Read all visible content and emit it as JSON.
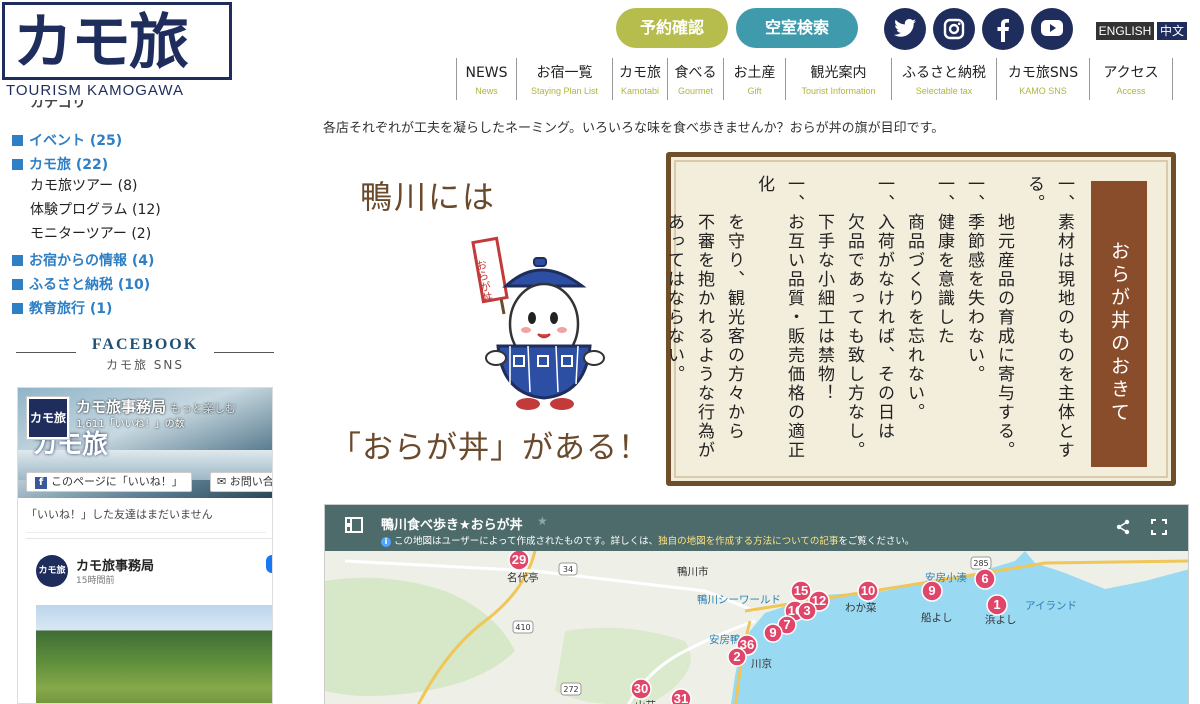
{
  "header": {
    "logo_jp": "カモ旅",
    "logo_en": "TOURISM KAMOGAWA",
    "btn_reserve": "予約確認",
    "btn_vacancy": "空室検索",
    "lang_en": "ENGLISH",
    "lang_zh": "中文",
    "social": [
      "twitter-icon",
      "instagram-icon",
      "facebook-icon",
      "youtube-icon"
    ],
    "nav": [
      {
        "jp": "NEWS",
        "en": "News"
      },
      {
        "jp": "お宿一覧",
        "en": "Staying Plan List"
      },
      {
        "jp": "カモ旅",
        "en": "Kamotabi"
      },
      {
        "jp": "食べる",
        "en": "Gourmet"
      },
      {
        "jp": "お土産",
        "en": "Gift"
      },
      {
        "jp": "観光案内",
        "en": "Tourist Information"
      },
      {
        "jp": "ふるさと納税",
        "en": "Selectable tax"
      },
      {
        "jp": "カモ旅SNS",
        "en": "KAMO SNS"
      },
      {
        "jp": "アクセス",
        "en": "Access"
      }
    ]
  },
  "sidebar": {
    "category_heading": "カテゴリー",
    "categories": [
      {
        "label": "イベント (25)"
      },
      {
        "label": "カモ旅 (22)",
        "children": [
          "カモ旅ツアー (8)",
          "体験プログラム (12)",
          "モニターツアー (2)"
        ]
      },
      {
        "label": "お宿からの情報 (4)"
      },
      {
        "label": "ふるさと納税 (10)"
      },
      {
        "label": "教育旅行 (1)"
      }
    ],
    "facebook": {
      "title": "FACEBOOK",
      "subtitle": "カモ旅 SNS",
      "page_name": "カモ旅事務局",
      "likes": "1,611「いいね！」の数",
      "cover_text": "カモ旅",
      "cover_tagline": "もっと楽しむ",
      "like_button": "このページに「いいね！」",
      "contact_button": "お問い合",
      "friends_note": "「いいね！」した友達はまだいません",
      "post_name": "カモ旅事務局",
      "post_time": "15時間前"
    }
  },
  "main": {
    "intro": "各店それぞれが工夫を凝らしたネーミング。いろいろな味を食べ歩きませんか？おらが丼の旗が目印です。",
    "illust_top": "鴨川には",
    "illust_bottom": "「おらが丼」がある！",
    "mascot_flag": "おらが丼",
    "rules_title": "おらが丼のおきて",
    "rules": [
      "一、素材は現地のものを主体とする。",
      "　　地元産品の育成に寄与する。",
      "一、季節感を失わない。",
      "一、健康を意識した",
      "　　商品づくりを忘れない。",
      "一、入荷がなければ、その日は",
      "　　欠品であっても致し方なし。",
      "　　下手な小細工は禁物！",
      "一、お互い品質・販売価格の適正化",
      "　　を守り、観光客の方々から",
      "　　不審を抱かれるような行為が",
      "　　あってはならない。"
    ],
    "map": {
      "title": "鴨川食べ歩き★おらが丼",
      "note_prefix": "この地図はユーザーによって作成されたものです。詳しくは、",
      "note_link": "独自の地図を作成する方法についての記事",
      "note_suffix": "をご覧ください。",
      "places": [
        "名代亭",
        "鴨川市",
        "鴨川シーワールド",
        "安房鴨川",
        "わか菜",
        "安房小湊",
        "船よし",
        "浜よし",
        "アイランド",
        "川京",
        "山荘"
      ],
      "route_numbers": [
        "34",
        "410",
        "272",
        "285"
      ],
      "pins": [
        "29",
        "15",
        "12",
        "16",
        "3",
        "10",
        "9",
        "6",
        "1",
        "7",
        "9",
        "36",
        "2",
        "30",
        "31"
      ]
    }
  },
  "colors": {
    "navy": "#1f2d5c",
    "olive": "#b7bd4c",
    "teal": "#3f9aab",
    "link_blue": "#2f7fc4",
    "pin": "#e0456a"
  }
}
